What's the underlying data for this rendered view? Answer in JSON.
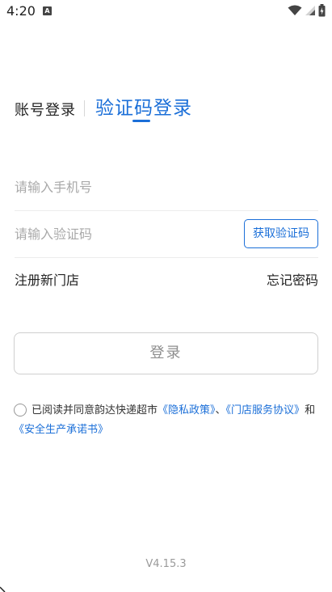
{
  "status_bar": {
    "time": "4:20",
    "notification_icon": "A",
    "icons": [
      "wifi-icon",
      "signal-icon",
      "battery-icon"
    ]
  },
  "tabs": {
    "account_login": "账号登录",
    "code_login": "验证码登录",
    "active": "code_login"
  },
  "form": {
    "phone_placeholder": "请输入手机号",
    "code_placeholder": "请输入验证码",
    "get_code_label": "获取验证码"
  },
  "links": {
    "register": "注册新门店",
    "forgot_password": "忘记密码"
  },
  "login_button": "登录",
  "agreement": {
    "checked": false,
    "prefix": "已阅读并同意韵达快递超市",
    "privacy_policy": "《隐私政策》",
    "separator": "、",
    "service_agreement": "《门店服务协议》",
    "conjunction": "和",
    "safety_commitment": "《安全生产承诺书》"
  },
  "version": "V4.15.3",
  "colors": {
    "accent": "#1b6fd8",
    "placeholder": "#a9a9a9",
    "border": "#cfcfcf"
  }
}
